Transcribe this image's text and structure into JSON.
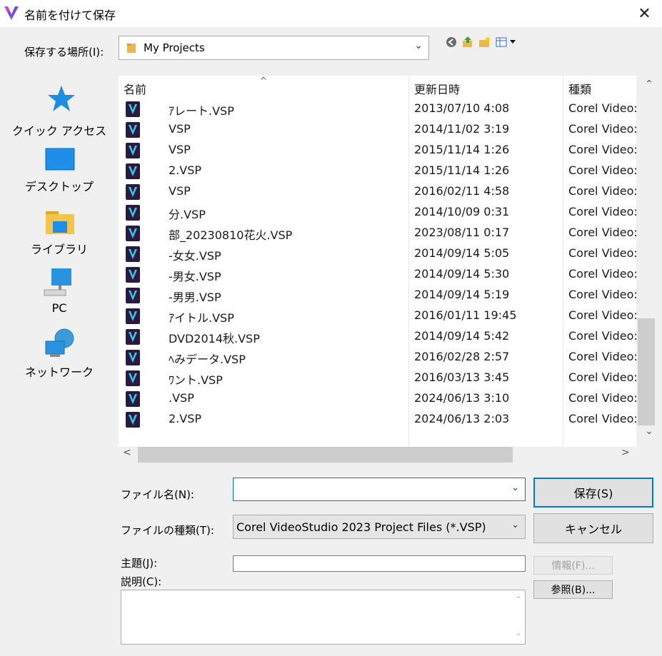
{
  "window": {
    "title": "名前を付けて保存",
    "close_glyph": "✕",
    "logo_color": "#7b3fe4"
  },
  "location": {
    "label": "保存する場所(I):",
    "value": "My Projects",
    "toolbar_icons": [
      "back-icon",
      "up-folder-icon",
      "new-folder-icon",
      "view-menu-icon"
    ]
  },
  "sidebar": {
    "items": [
      {
        "label": "クイック アクセス",
        "icon": "quick-access-star-icon"
      },
      {
        "label": "デスクトップ",
        "icon": "desktop-icon"
      },
      {
        "label": "ライブラリ",
        "icon": "library-folder-icon"
      },
      {
        "label": "PC",
        "icon": "pc-icon"
      },
      {
        "label": "ネットワーク",
        "icon": "network-icon"
      }
    ]
  },
  "filelist": {
    "columns": [
      "名前",
      "更新日時",
      "種類"
    ],
    "sort_glyph": "^",
    "rows": [
      {
        "name": "ｱレート.VSP",
        "date": "2013/07/10 4:08",
        "type": "Corel Video:"
      },
      {
        "name": "VSP",
        "date": "2014/11/02 3:19",
        "type": "Corel Video:"
      },
      {
        "name": "VSP",
        "date": "2015/11/14 1:26",
        "type": "Corel Video:"
      },
      {
        "name": "2.VSP",
        "date": "2015/11/14 1:26",
        "type": "Corel Video:"
      },
      {
        "name": "VSP",
        "date": "2016/02/11 4:58",
        "type": "Corel Video:"
      },
      {
        "name": "分.VSP",
        "date": "2014/10/09 0:31",
        "type": "Corel Video:"
      },
      {
        "name": "部_20230810花火.VSP",
        "date": "2023/08/11 0:17",
        "type": "Corel Video:"
      },
      {
        "name": "-女女.VSP",
        "date": "2014/09/14 5:05",
        "type": "Corel Video:"
      },
      {
        "name": "-男女.VSP",
        "date": "2014/09/14 5:30",
        "type": "Corel Video:"
      },
      {
        "name": "-男男.VSP",
        "date": "2014/09/14 5:19",
        "type": "Corel Video:"
      },
      {
        "name": "ｱイトル.VSP",
        "date": "2016/01/11 19:45",
        "type": "Corel Video:"
      },
      {
        "name": "DVD2014秋.VSP",
        "date": "2014/09/14 5:42",
        "type": "Corel Video:"
      },
      {
        "name": "ﾍみデータ.VSP",
        "date": "2016/02/28 2:57",
        "type": "Corel Video:"
      },
      {
        "name": "ﾜント.VSP",
        "date": "2016/03/13 3:45",
        "type": "Corel Video:"
      },
      {
        "name": ".VSP",
        "date": "2024/06/13 3:10",
        "type": "Corel Video:"
      },
      {
        "name": "2.VSP",
        "date": "2024/06/13 2:03",
        "type": "Corel Video:"
      }
    ]
  },
  "scroll": {
    "up": "⌃",
    "down": "⌄",
    "left": "<",
    "right": ">"
  },
  "form": {
    "filename_label": "ファイル名(N):",
    "filename_value": "",
    "filetype_label": "ファイルの種類(T):",
    "filetype_value": "Corel VideoStudio 2023 Project Files (*.VSP)",
    "subject_label": "主題(J):",
    "subject_value": "",
    "description_label": "説明(C):",
    "save_button": "保存(S)",
    "cancel_button": "キャンセル",
    "info_button": "情報(F)...",
    "browse_button": "参照(B)..."
  },
  "colors": {
    "accent": "#0078d7",
    "file_icon_bg": "#2b1a3d",
    "file_icon_v": "#39c6e8"
  }
}
